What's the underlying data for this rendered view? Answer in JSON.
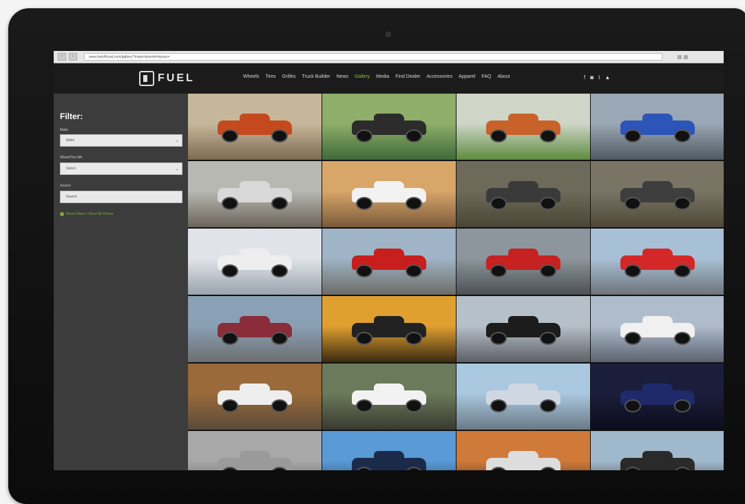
{
  "browser": {
    "back_label": "‹",
    "forward_label": "›",
    "url": "www.fueloffroad.com/gallery/?make=&model=&year="
  },
  "site": {
    "logo_text": "FUEL",
    "nav": [
      {
        "label": "Wheels",
        "active": false
      },
      {
        "label": "Tires",
        "active": false
      },
      {
        "label": "Grilles",
        "active": false
      },
      {
        "label": "Truck Builder",
        "active": false
      },
      {
        "label": "News",
        "active": false
      },
      {
        "label": "Gallery",
        "active": true
      },
      {
        "label": "Media",
        "active": false
      },
      {
        "label": "Find Dealer",
        "active": false
      },
      {
        "label": "Accessories",
        "active": false
      },
      {
        "label": "Apparel",
        "active": false
      },
      {
        "label": "FAQ",
        "active": false
      },
      {
        "label": "About",
        "active": false
      }
    ],
    "social": [
      "f",
      "◙",
      "t",
      "▲"
    ]
  },
  "filter": {
    "title": "Filter:",
    "make_label": "Make",
    "make_value": "Make",
    "model_label": "Wheel/Tire Mfr",
    "model_value": "Select",
    "year_label": "Search",
    "year_value": "Search",
    "reset_label": "Reset Filters / Show All Photos"
  },
  "gallery": {
    "tiles": [
      {
        "bg1": "#c7b79a",
        "bg2": "#7d6a52",
        "color": "#c44a1e",
        "icon": "truck-photo"
      },
      {
        "bg1": "#8fae6a",
        "bg2": "#3e6a3a",
        "color": "#2c2c2c",
        "icon": "truck-photo"
      },
      {
        "bg1": "#cfd6c8",
        "bg2": "#5e8c3e",
        "color": "#c9622a",
        "icon": "truck-photo"
      },
      {
        "bg1": "#9aa7b4",
        "bg2": "#4f5a63",
        "color": "#2d54b8",
        "icon": "truck-photo"
      },
      {
        "bg1": "#b8b8b2",
        "bg2": "#6c645a",
        "color": "#d8d8d8",
        "icon": "truck-photo"
      },
      {
        "bg1": "#d9a66a",
        "bg2": "#7a5a3a",
        "color": "#f2f2f2",
        "icon": "truck-photo"
      },
      {
        "bg1": "#6e6a5a",
        "bg2": "#4a4636",
        "color": "#3a3a3a",
        "icon": "truck-photo"
      },
      {
        "bg1": "#7a7464",
        "bg2": "#4e4838",
        "color": "#3e3e3e",
        "icon": "truck-photo"
      },
      {
        "bg1": "#e0e4ea",
        "bg2": "#9aa4ac",
        "color": "#eeeeee",
        "icon": "truck-photo"
      },
      {
        "bg1": "#9fb4c6",
        "bg2": "#6c6c66",
        "color": "#c81e1e",
        "icon": "truck-photo"
      },
      {
        "bg1": "#8c969c",
        "bg2": "#4c5054",
        "color": "#c62222",
        "icon": "truck-photo"
      },
      {
        "bg1": "#a8c0d6",
        "bg2": "#6e747a",
        "color": "#d42828",
        "icon": "truck-photo"
      },
      {
        "bg1": "#8aa0b4",
        "bg2": "#6c6e70",
        "color": "#8a2c3a",
        "icon": "truck-photo"
      },
      {
        "bg1": "#e0a030",
        "bg2": "#3a2a10",
        "color": "#222222",
        "icon": "truck-photo"
      },
      {
        "bg1": "#b6c0c8",
        "bg2": "#5c6066",
        "color": "#1c1c1c",
        "icon": "truck-photo"
      },
      {
        "bg1": "#aebccc",
        "bg2": "#5c6270",
        "color": "#f0f0f0",
        "icon": "truck-photo"
      },
      {
        "bg1": "#9a6a3a",
        "bg2": "#5a4a3a",
        "color": "#eeeeee",
        "icon": "truck-photo"
      },
      {
        "bg1": "#6a7a5a",
        "bg2": "#3a3a30",
        "color": "#f2f2f2",
        "icon": "truck-photo"
      },
      {
        "bg1": "#aac8e0",
        "bg2": "#6a7a86",
        "color": "#cfd8e2",
        "icon": "truck-photo"
      },
      {
        "bg1": "#1a1e3a",
        "bg2": "#0c0c1c",
        "color": "#1e2a6a",
        "icon": "truck-photo"
      },
      {
        "bg1": "#a8a8a8",
        "bg2": "#5a5a5a",
        "color": "#9a9a9a",
        "icon": "truck-photo"
      },
      {
        "bg1": "#5a9ad6",
        "bg2": "#2a3a5a",
        "color": "#1c2a4a",
        "icon": "truck-photo"
      },
      {
        "bg1": "#d07a3a",
        "bg2": "#3a2a20",
        "color": "#dddddd",
        "icon": "truck-photo"
      },
      {
        "bg1": "#a0b8cc",
        "bg2": "#3a3a3a",
        "color": "#2a2a2a",
        "icon": "truck-photo"
      }
    ]
  }
}
